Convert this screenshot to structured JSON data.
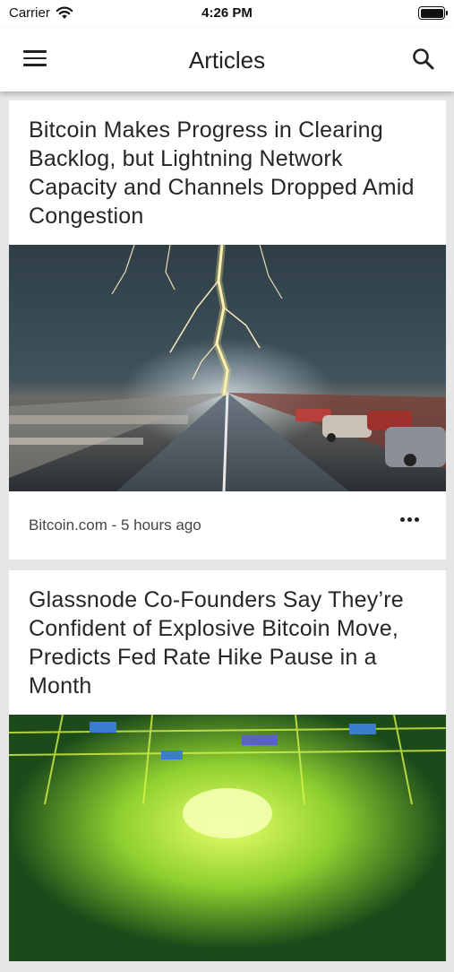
{
  "status_bar": {
    "carrier": "Carrier",
    "time": "4:26 PM"
  },
  "app_bar": {
    "title": "Articles",
    "menu_icon": "hamburger-menu-icon",
    "search_icon": "search-icon"
  },
  "articles": [
    {
      "title": "Bitcoin Makes Progress in Clearing Backlog, but Lightning Network Capacity and Channels Dropped Amid Congestion",
      "source": "Bitcoin.com - 5 hours ago",
      "image": "lightning-storm-over-highway"
    },
    {
      "title": "Glassnode Co-Founders Say They’re Confident of Explosive Bitcoin Move, Predicts Fed Rate Hike Pause in a Month",
      "image": "glowing-circuit-board-bitcoin"
    }
  ],
  "colors": {
    "background": "#e6e6e6",
    "card": "#ffffff",
    "text": "#262626"
  }
}
